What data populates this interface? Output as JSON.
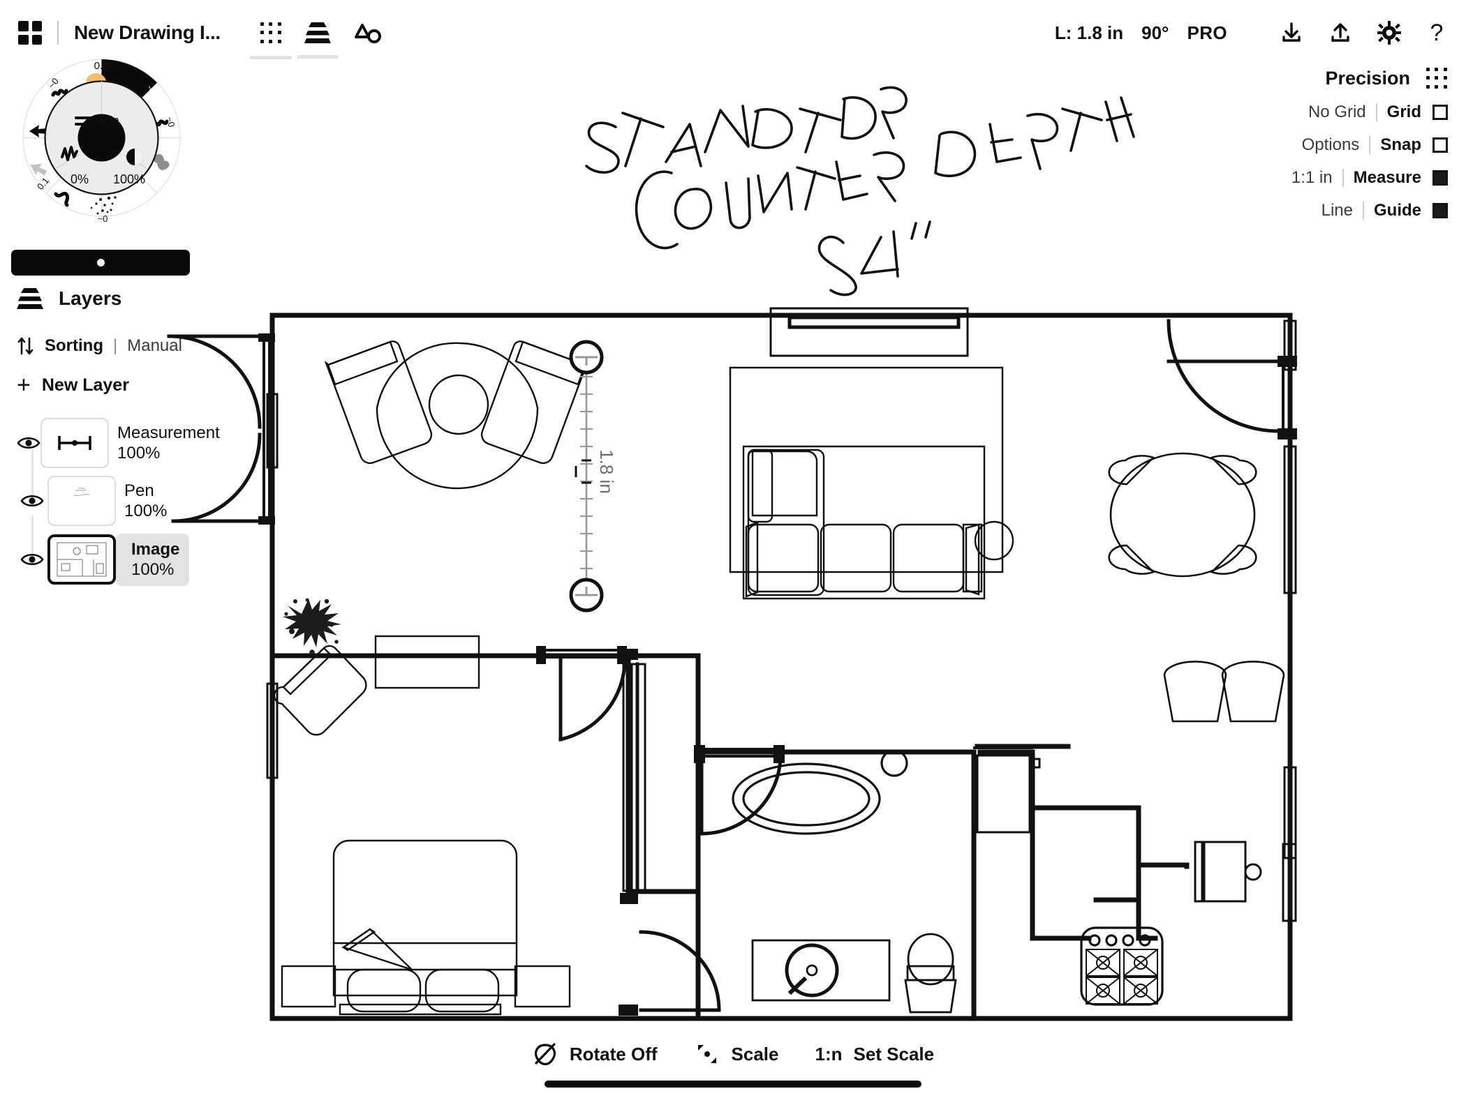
{
  "header": {
    "app_logo_icon": "grid-squares-icon",
    "doc_title": "New Drawing I...",
    "tools": [
      {
        "name": "dot-grid-icon",
        "label": "Grid Tool",
        "active": true
      },
      {
        "name": "layers-stack-icon",
        "label": "Layers Tool",
        "active": true
      },
      {
        "name": "shape-snap-icon",
        "label": "Shape Tool",
        "active": false
      }
    ],
    "length_status": "L: 1.8 in",
    "angle_status": "90°",
    "pro_badge": "PRO",
    "right_icons": [
      {
        "name": "download-icon",
        "label": "Import"
      },
      {
        "name": "upload-icon",
        "label": "Export"
      },
      {
        "name": "gear-icon",
        "label": "Settings"
      },
      {
        "name": "help-icon",
        "label": "Help"
      }
    ]
  },
  "precision": {
    "title": "Precision",
    "menu_icon": "dot-grid-icon",
    "rows": [
      {
        "option": "No Grid",
        "label": "Grid",
        "checked": false
      },
      {
        "option": "Options",
        "label": "Snap",
        "checked": false
      },
      {
        "option": "1:1 in",
        "label": "Measure",
        "checked": true
      },
      {
        "option": "Line",
        "label": "Guide",
        "checked": true
      }
    ]
  },
  "wheel": {
    "size_label": "~0 in",
    "min_label": "0%",
    "max_label": "100%",
    "segment_labels": [
      "0.9",
      "~0",
      "~0",
      "0.1",
      "~0",
      "~0"
    ],
    "accent_color": "#efbe6e",
    "active_segment_color": "#0a0a0a"
  },
  "layers": {
    "icon": "layers-stack-icon",
    "title": "Layers",
    "sorting_icon": "sort-arrows-icon",
    "sorting_label": "Sorting",
    "sorting_sep": "|",
    "sorting_value": "Manual",
    "new_layer_label": "New Layer",
    "items": [
      {
        "name": "Measurement",
        "opacity": "100%",
        "thumb_icon": "measure-bar-icon",
        "visible": true,
        "selected": false
      },
      {
        "name": "Pen",
        "opacity": "100%",
        "thumb_icon": "pen-scribble-icon",
        "visible": true,
        "selected": false
      },
      {
        "name": "Image",
        "opacity": "100%",
        "thumb_icon": "floorplan-thumb-icon",
        "visible": true,
        "selected": true
      }
    ]
  },
  "canvas": {
    "annotation_lines": [
      "STANDARD",
      "COUNTER DEPTH",
      "24\""
    ],
    "measurement_label": "1.8 in",
    "measurement_orientation": "vertical"
  },
  "bottombar": {
    "items": [
      {
        "icon": "rotate-off-icon",
        "label": "Rotate Off"
      },
      {
        "icon": "scale-corner-icon",
        "label": "Scale"
      },
      {
        "icon": "ratio-icon",
        "label": "1:n",
        "is_text_icon": true
      },
      {
        "icon": "",
        "label": "Set Scale"
      }
    ]
  }
}
